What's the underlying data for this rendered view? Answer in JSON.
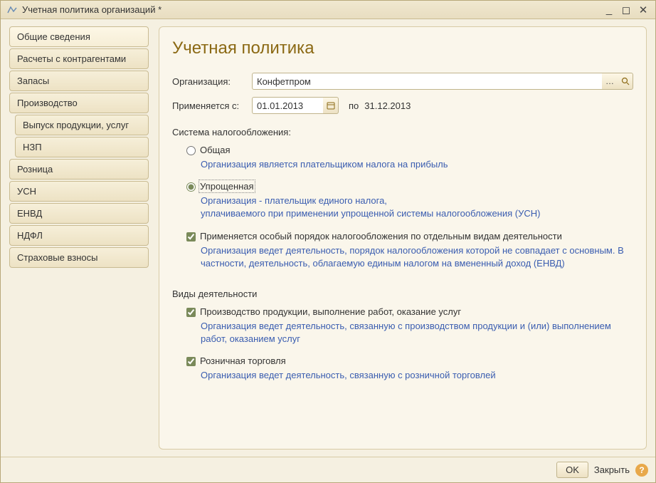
{
  "window": {
    "title": "Учетная политика организаций *"
  },
  "sidebar": {
    "items": [
      {
        "label": "Общие сведения",
        "child": false,
        "selected": true
      },
      {
        "label": "Расчеты с контрагентами",
        "child": false,
        "selected": false
      },
      {
        "label": "Запасы",
        "child": false,
        "selected": false
      },
      {
        "label": "Производство",
        "child": false,
        "selected": false
      },
      {
        "label": "Выпуск продукции, услуг",
        "child": true,
        "selected": false
      },
      {
        "label": "НЗП",
        "child": true,
        "selected": false
      },
      {
        "label": "Розница",
        "child": false,
        "selected": false
      },
      {
        "label": "УСН",
        "child": false,
        "selected": false
      },
      {
        "label": "ЕНВД",
        "child": false,
        "selected": false
      },
      {
        "label": "НДФЛ",
        "child": false,
        "selected": false
      },
      {
        "label": "Страховые взносы",
        "child": false,
        "selected": false
      }
    ]
  },
  "main": {
    "heading": "Учетная политика",
    "org_label": "Организация:",
    "org_value": "Конфетпром",
    "applies_from_label": "Применяется с:",
    "applies_from_value": "01.01.2013",
    "applies_to_prefix": "по",
    "applies_to_value": "31.12.2013",
    "tax_system_label": "Система налогообложения:",
    "tax_options": [
      {
        "label": "Общая",
        "checked": false,
        "desc": "Организация является плательщиком налога на прибыль"
      },
      {
        "label": "Упрощенная",
        "checked": true,
        "desc": "Организация - плательщик единого налога,\nуплачиваемого при применении упрощенной системы налогообложения (УСН)"
      }
    ],
    "special_check": {
      "label": "Применяется особый порядок налогообложения по отдельным видам деятельности",
      "checked": true,
      "desc": "Организация ведет деятельность, порядок налогообложения которой не совпадает с основным. В частности, деятельность, облагаемую единым налогом на вмененный доход (ЕНВД)"
    },
    "activities_label": "Виды деятельности",
    "activities": [
      {
        "label": "Производство  продукции, выполнение работ, оказание услуг",
        "checked": true,
        "desc": "Организация ведет деятельность, связанную с производством продукции и (или) выполнением работ, оказанием услуг"
      },
      {
        "label": "Розничная торговля",
        "checked": true,
        "desc": "Организация ведет деятельность, связанную с розничной торговлей"
      }
    ]
  },
  "footer": {
    "ok": "OK",
    "close": "Закрыть"
  }
}
